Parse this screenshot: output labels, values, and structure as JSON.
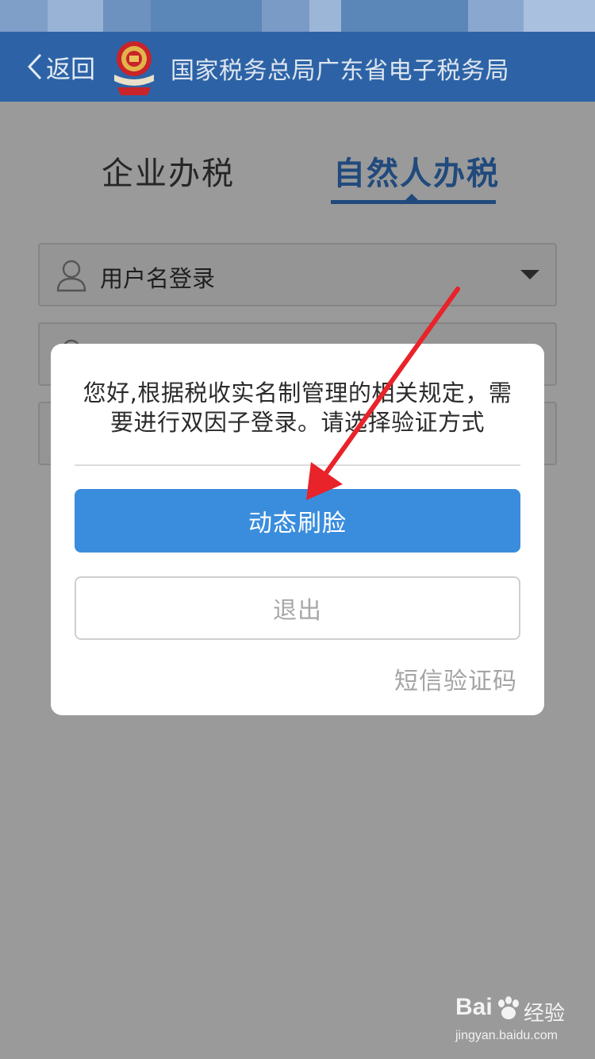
{
  "header": {
    "back_label": "返回",
    "title": "国家税务总局广东省电子税务局"
  },
  "tabs": [
    {
      "label": "企业办税",
      "active": false
    },
    {
      "label": "自然人办税",
      "active": true
    }
  ],
  "login_form": {
    "login_type": {
      "value": "用户名登录",
      "icon": "user-icon"
    }
  },
  "dialog": {
    "message_line1": "您好,根据税收实名制管理的相关规定，需",
    "message_line2": "要进行双因子登录。请选择验证方式",
    "primary_button": "动态刷脸",
    "secondary_button": "退出",
    "sms_link": "短信验证码"
  },
  "watermark": {
    "brand": "Bai",
    "brand_suffix": "经验",
    "url": "jingyan.baidu.com"
  },
  "colors": {
    "header_bg": "#2d63a6",
    "active_tab": "#214a7c",
    "primary_button": "#3a8ddd",
    "annotation_arrow": "#e8232a",
    "overlay_bg": "#9a9a9a"
  }
}
